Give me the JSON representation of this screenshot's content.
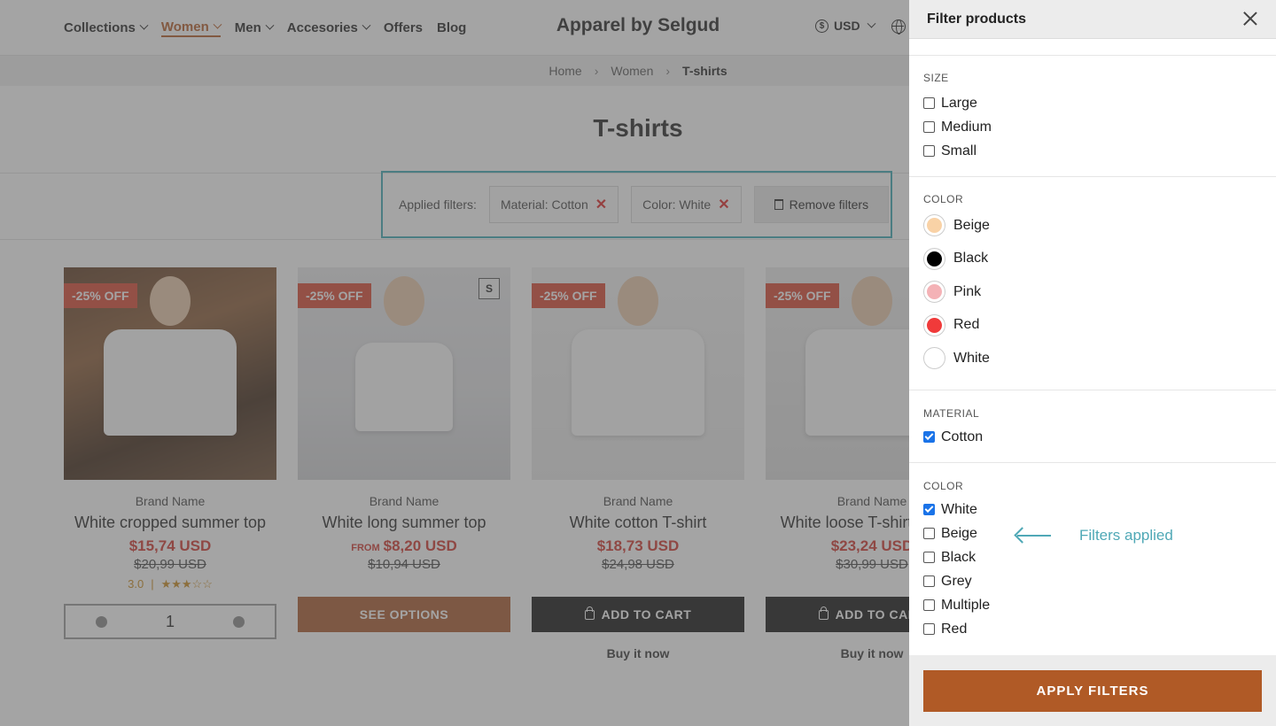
{
  "header": {
    "nav": [
      {
        "label": "Collections",
        "has_dropdown": true
      },
      {
        "label": "Women",
        "has_dropdown": true,
        "active": true
      },
      {
        "label": "Men",
        "has_dropdown": true
      },
      {
        "label": "Accesories",
        "has_dropdown": true
      },
      {
        "label": "Offers",
        "has_dropdown": false
      },
      {
        "label": "Blog",
        "has_dropdown": false
      }
    ],
    "logo": "Apparel by Selgud",
    "currency": "USD",
    "currency_icon": "dollar-coin-icon",
    "language_icon": "globe-icon"
  },
  "breadcrumb": {
    "home": "Home",
    "section": "Women",
    "current": "T-shirts"
  },
  "page_title": "T-shirts",
  "applied_filters": {
    "label": "Applied filters:",
    "chips": [
      "Material: Cotton",
      "Color: White"
    ],
    "remove_label": "Remove filters",
    "highlight_color": "#3aa8b3"
  },
  "products": [
    {
      "badge": "-25% OFF",
      "brand": "Brand Name",
      "name": "White cropped summer top",
      "price": "$15,74 USD",
      "old_price": "$20,99 USD",
      "rating": "3.0",
      "stars": 3,
      "quantity": "1"
    },
    {
      "badge": "-25% OFF",
      "size_tag": "S",
      "brand": "Brand Name",
      "name": "White long summer top",
      "price_prefix": "FROM",
      "price": "$8,20 USD",
      "old_price": "$10,94 USD",
      "action": "SEE OPTIONS"
    },
    {
      "badge": "-25% OFF",
      "brand": "Brand Name",
      "name": "White cotton T-shirt",
      "price": "$18,73 USD",
      "old_price": "$24,98 USD",
      "action": "ADD TO CART",
      "secondary": "Buy it now"
    },
    {
      "badge": "-25% OFF",
      "brand": "Brand Name",
      "name": "White loose T-shirt design",
      "price": "$23,24 USD",
      "old_price": "$30,99 USD",
      "action": "ADD TO CART",
      "secondary": "Buy it now"
    }
  ],
  "panel": {
    "title": "Filter products",
    "sections": {
      "size": {
        "label": "SIZE",
        "options": [
          {
            "label": "Large",
            "checked": false
          },
          {
            "label": "Medium",
            "checked": false
          },
          {
            "label": "Small",
            "checked": false
          }
        ]
      },
      "color_swatches": {
        "label": "COLOR",
        "options": [
          {
            "label": "Beige",
            "color": "#f9d2a6"
          },
          {
            "label": "Black",
            "color": "#000000"
          },
          {
            "label": "Pink",
            "color": "#f4b2b6"
          },
          {
            "label": "Red",
            "color": "#f03a3a"
          },
          {
            "label": "White",
            "color": "#ffffff"
          }
        ]
      },
      "material": {
        "label": "MATERIAL",
        "options": [
          {
            "label": "Cotton",
            "checked": true
          }
        ]
      },
      "color_list": {
        "label": "COLOR",
        "options": [
          {
            "label": "White",
            "checked": true
          },
          {
            "label": "Beige",
            "checked": false
          },
          {
            "label": "Black",
            "checked": false
          },
          {
            "label": "Grey",
            "checked": false
          },
          {
            "label": "Multiple",
            "checked": false
          },
          {
            "label": "Red",
            "checked": false
          }
        ]
      }
    },
    "annotation": "Filters applied",
    "apply_label": "APPLY FILTERS"
  },
  "colors": {
    "accent": "#b05a26",
    "sale": "#d0342c",
    "badge": "#d9452f",
    "annotation": "#4fa8b6"
  }
}
